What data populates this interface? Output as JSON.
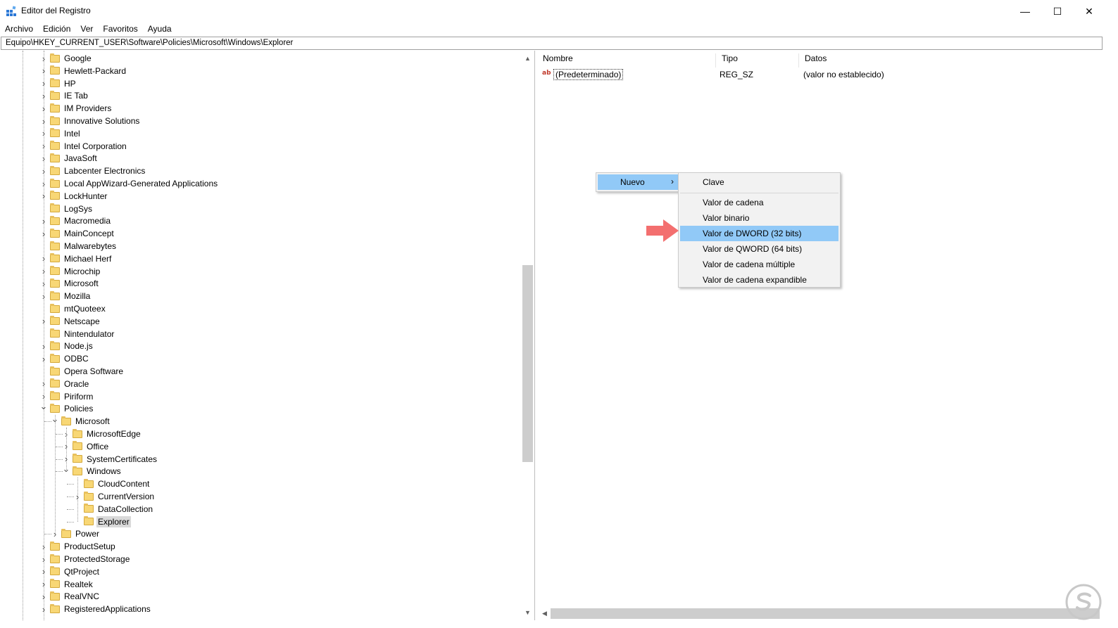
{
  "window": {
    "title": "Editor del Registro",
    "minimize_glyph": "—",
    "maximize_glyph": "☐",
    "close_glyph": "✕"
  },
  "menubar": {
    "items": [
      "Archivo",
      "Edición",
      "Ver",
      "Favoritos",
      "Ayuda"
    ]
  },
  "address": {
    "path": "Equipo\\HKEY_CURRENT_USER\\Software\\Policies\\Microsoft\\Windows\\Explorer"
  },
  "tree": {
    "nodes": [
      {
        "label": "Google",
        "level": 0,
        "expander": "collapsed"
      },
      {
        "label": "Hewlett-Packard",
        "level": 0,
        "expander": "collapsed"
      },
      {
        "label": "HP",
        "level": 0,
        "expander": "collapsed"
      },
      {
        "label": "IE Tab",
        "level": 0,
        "expander": "collapsed"
      },
      {
        "label": "IM Providers",
        "level": 0,
        "expander": "collapsed"
      },
      {
        "label": "Innovative Solutions",
        "level": 0,
        "expander": "collapsed"
      },
      {
        "label": "Intel",
        "level": 0,
        "expander": "collapsed"
      },
      {
        "label": "Intel Corporation",
        "level": 0,
        "expander": "collapsed"
      },
      {
        "label": "JavaSoft",
        "level": 0,
        "expander": "collapsed"
      },
      {
        "label": "Labcenter Electronics",
        "level": 0,
        "expander": "collapsed"
      },
      {
        "label": "Local AppWizard-Generated Applications",
        "level": 0,
        "expander": "collapsed"
      },
      {
        "label": "LockHunter",
        "level": 0,
        "expander": "collapsed"
      },
      {
        "label": "LogSys",
        "level": 0,
        "expander": "none"
      },
      {
        "label": "Macromedia",
        "level": 0,
        "expander": "collapsed"
      },
      {
        "label": "MainConcept",
        "level": 0,
        "expander": "collapsed"
      },
      {
        "label": "Malwarebytes",
        "level": 0,
        "expander": "none"
      },
      {
        "label": "Michael Herf",
        "level": 0,
        "expander": "collapsed"
      },
      {
        "label": "Microchip",
        "level": 0,
        "expander": "collapsed"
      },
      {
        "label": "Microsoft",
        "level": 0,
        "expander": "collapsed"
      },
      {
        "label": "Mozilla",
        "level": 0,
        "expander": "collapsed"
      },
      {
        "label": "mtQuoteex",
        "level": 0,
        "expander": "none"
      },
      {
        "label": "Netscape",
        "level": 0,
        "expander": "collapsed"
      },
      {
        "label": "Nintendulator",
        "level": 0,
        "expander": "none"
      },
      {
        "label": "Node.js",
        "level": 0,
        "expander": "collapsed"
      },
      {
        "label": "ODBC",
        "level": 0,
        "expander": "collapsed"
      },
      {
        "label": "Opera Software",
        "level": 0,
        "expander": "none"
      },
      {
        "label": "Oracle",
        "level": 0,
        "expander": "collapsed"
      },
      {
        "label": "Piriform",
        "level": 0,
        "expander": "collapsed"
      },
      {
        "label": "Policies",
        "level": 0,
        "expander": "expanded"
      },
      {
        "label": "Microsoft",
        "level": 1,
        "expander": "expanded"
      },
      {
        "label": "MicrosoftEdge",
        "level": 2,
        "expander": "collapsed"
      },
      {
        "label": "Office",
        "level": 2,
        "expander": "collapsed"
      },
      {
        "label": "SystemCertificates",
        "level": 2,
        "expander": "collapsed"
      },
      {
        "label": "Windows",
        "level": 2,
        "expander": "expanded"
      },
      {
        "label": "CloudContent",
        "level": 3,
        "expander": "none"
      },
      {
        "label": "CurrentVersion",
        "level": 3,
        "expander": "collapsed"
      },
      {
        "label": "DataCollection",
        "level": 3,
        "expander": "none"
      },
      {
        "label": "Explorer",
        "level": 3,
        "expander": "none",
        "selected": true
      },
      {
        "label": "Power",
        "level": 1,
        "expander": "collapsed"
      },
      {
        "label": "ProductSetup",
        "level": 0,
        "expander": "collapsed"
      },
      {
        "label": "ProtectedStorage",
        "level": 0,
        "expander": "collapsed"
      },
      {
        "label": "QtProject",
        "level": 0,
        "expander": "collapsed"
      },
      {
        "label": "Realtek",
        "level": 0,
        "expander": "collapsed"
      },
      {
        "label": "RealVNC",
        "level": 0,
        "expander": "collapsed"
      },
      {
        "label": "RegisteredApplications",
        "level": 0,
        "expander": "collapsed"
      }
    ]
  },
  "list": {
    "columns": {
      "name": "Nombre",
      "type": "Tipo",
      "data": "Datos"
    },
    "rows": [
      {
        "icon": "string-value-icon",
        "icon_text": "ab",
        "name": "(Predeterminado)",
        "type": "REG_SZ",
        "data": "(valor no establecido)"
      }
    ]
  },
  "context_menu": {
    "item": "Nuevo",
    "chevron": "›"
  },
  "submenu": {
    "items": [
      "Clave",
      "Valor de cadena",
      "Valor binario",
      "Valor de DWORD (32 bits)",
      "Valor de QWORD (64 bits)",
      "Valor de cadena múltiple",
      "Valor de cadena expandible"
    ],
    "highlighted_index": 3
  },
  "colors": {
    "highlight": "#91c9f7",
    "arrow": "#f36f6f",
    "folder": "#f8d775",
    "selection": "#d9d9d9"
  }
}
